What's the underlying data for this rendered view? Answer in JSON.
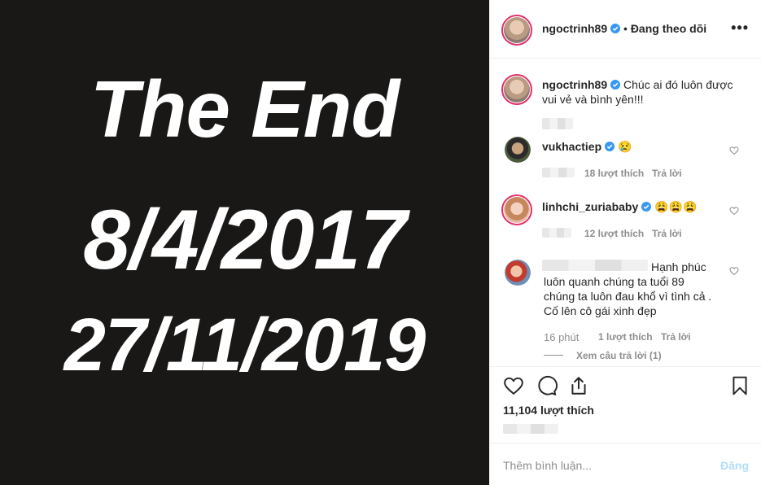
{
  "media": {
    "line1": "The End",
    "line2": "8/4/2017",
    "line3": "27/11/2019"
  },
  "header": {
    "username": "ngoctrinh89",
    "separator": " • ",
    "follow_label": "Đang theo dõi",
    "more_label": "•••"
  },
  "caption": {
    "username": "ngoctrinh89",
    "text": "Chúc ai đó luôn được vui vẻ và bình yên!!!"
  },
  "comments": [
    {
      "username": "vukhactiep",
      "text": "😢",
      "likes": "18 lượt thích",
      "reply": "Trả lời"
    },
    {
      "username": "linhchi_zuriababy",
      "text": "😩😩😩",
      "likes": "12 lượt thích",
      "reply": "Trả lời"
    },
    {
      "username": "",
      "text": "Hạnh phúc luôn quanh chúng ta tuổi 89 chúng ta luôn đau khổ vì tình cả . Cố lên cô gái xinh đẹp",
      "time": "16 phút",
      "likes": "1 lượt thích",
      "reply": "Trả lời",
      "view_replies": "Xem câu trả lời (1)"
    }
  ],
  "likes_count": "11,104 lượt thích",
  "add_comment": {
    "placeholder": "Thêm bình luận...",
    "post_label": "Đăng"
  },
  "colors": {
    "verified": "#3897f0",
    "post_disabled": "#b2dffc",
    "story_ring": "#e1306c"
  }
}
